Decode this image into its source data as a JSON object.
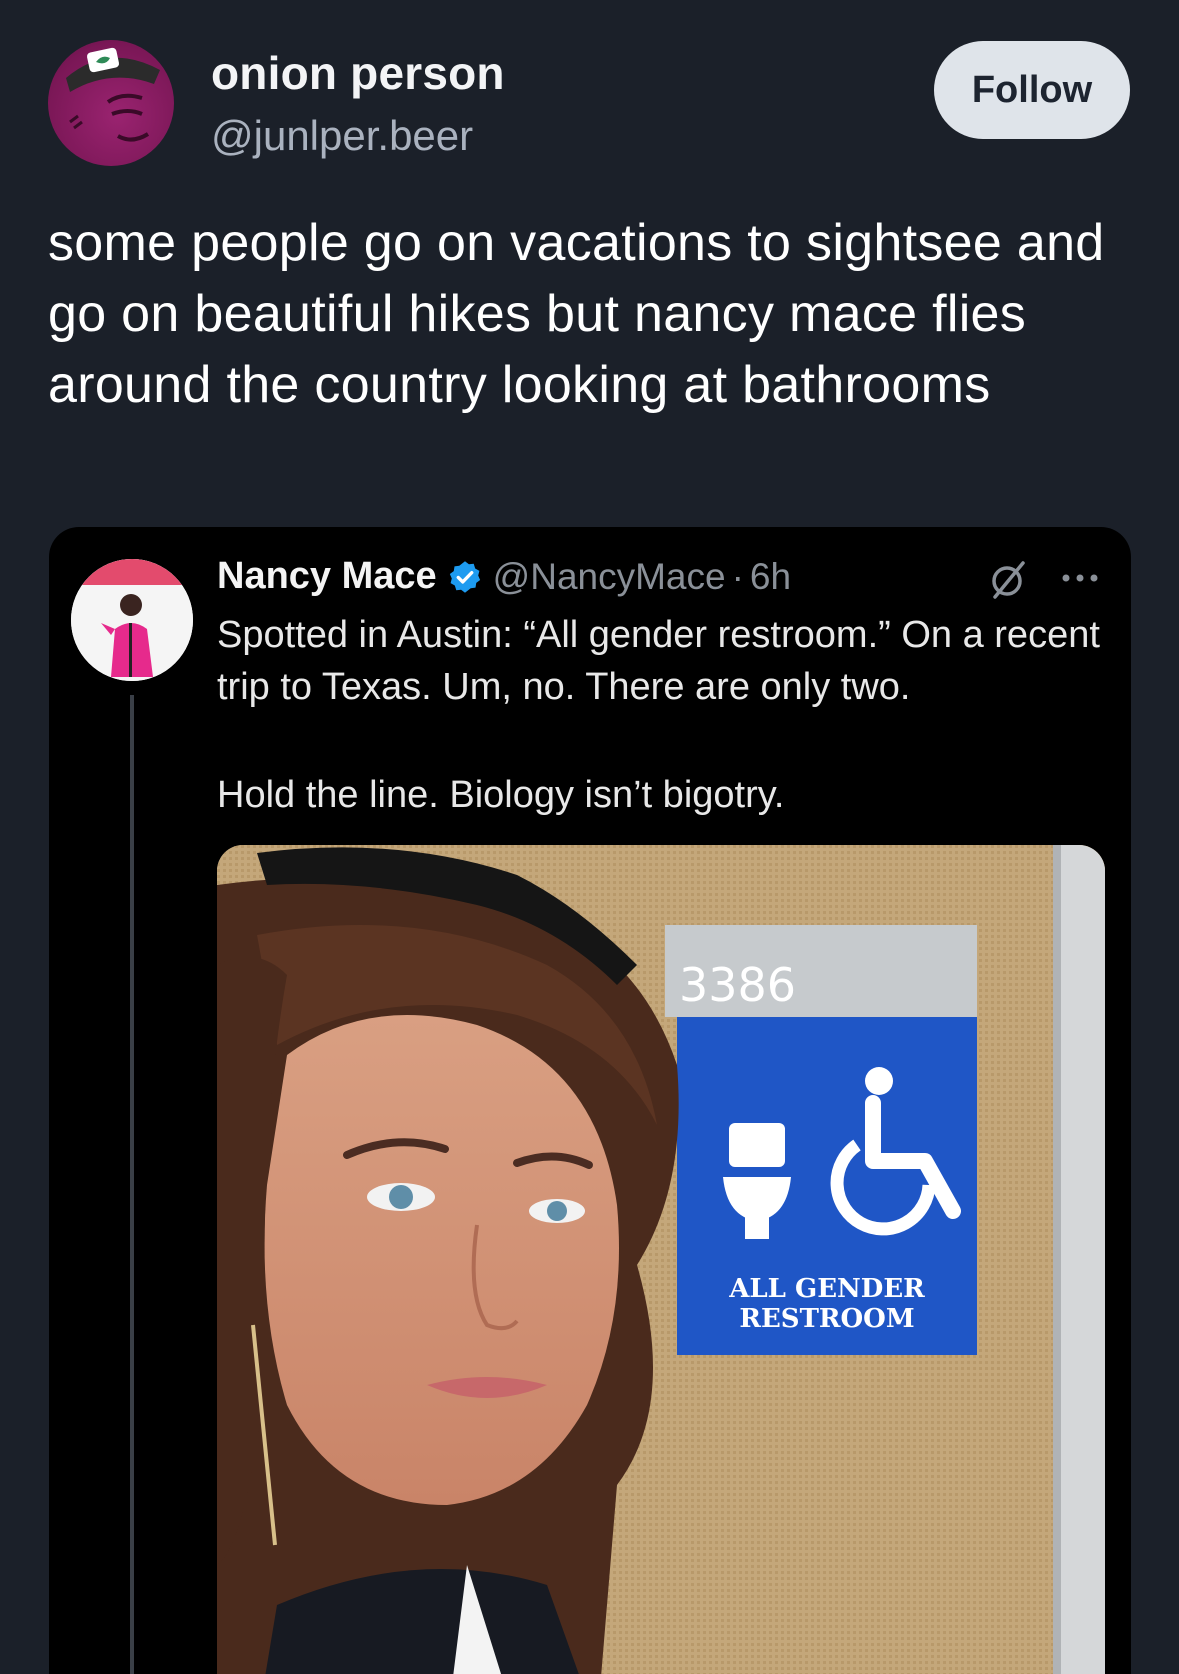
{
  "post": {
    "author_name": "onion person",
    "author_handle": "@junlper.beer",
    "follow_label": "Follow",
    "text": "some people go on vacations to sightsee and go on beautiful hikes but nancy mace flies around the country looking at bathrooms"
  },
  "quoted": {
    "name": "Nancy Mace",
    "handle": "@NancyMace",
    "separator": "·",
    "time": "6h",
    "text_line1": "Spotted in Austin: “All gender restroom.” On a recent trip to Texas. Um, no. There are only two.",
    "text_line2": "Hold the line. Biology isn’t bigotry.",
    "photo": {
      "room_number": "3386",
      "sign_line1": "ALL GENDER",
      "sign_line2": "RESTROOM"
    }
  },
  "icons": {
    "verified": "verified-badge-icon",
    "grok": "grok-icon",
    "more": "more-icon"
  },
  "colors": {
    "background": "#1b2029",
    "follow_button": "#dfe4ea",
    "verified": "#1d9bf0",
    "sign_blue": "#1f56c6"
  }
}
